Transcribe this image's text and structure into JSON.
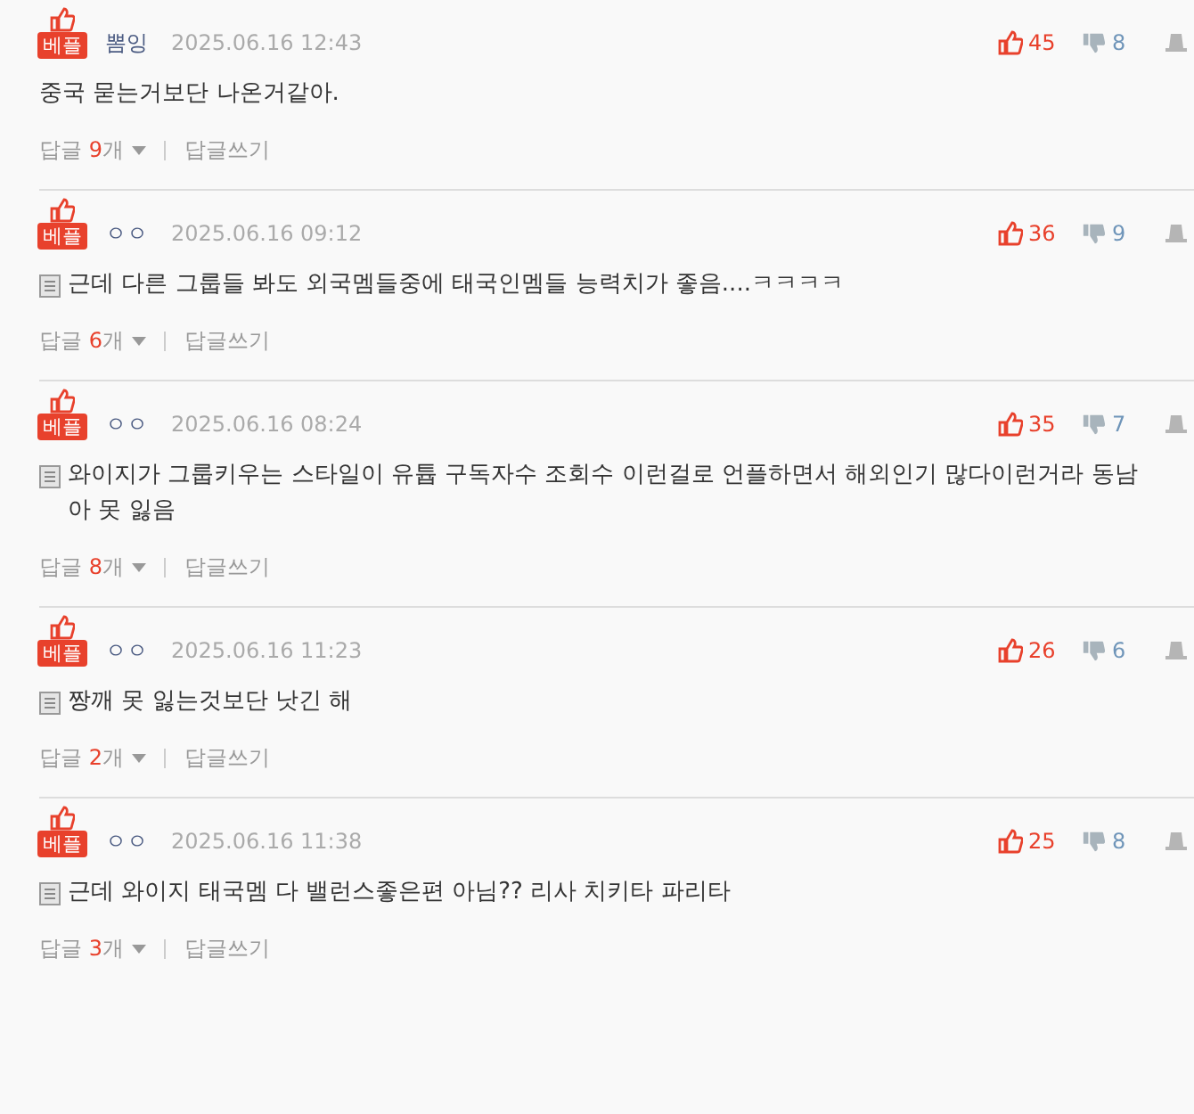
{
  "comments": [
    {
      "badge": "베플",
      "author": "뽐잉",
      "date": "2025.06.16 12:43",
      "up": "45",
      "down": "8",
      "memo_icon": false,
      "body": "중국 묻는거보단 나온거같아.",
      "reply_label": "답글",
      "reply_count": "9",
      "reply_unit": "개",
      "write_reply": "답글쓰기"
    },
    {
      "badge": "베플",
      "author": "ㅇㅇ",
      "date": "2025.06.16 09:12",
      "up": "36",
      "down": "9",
      "memo_icon": true,
      "body": "근데 다른 그룹들 봐도 외국멤들중에 태국인멤들 능력치가 좋음....ㅋㅋㅋㅋ",
      "reply_label": "답글",
      "reply_count": "6",
      "reply_unit": "개",
      "write_reply": "답글쓰기"
    },
    {
      "badge": "베플",
      "author": "ㅇㅇ",
      "date": "2025.06.16 08:24",
      "up": "35",
      "down": "7",
      "memo_icon": true,
      "body": "와이지가 그룹키우는 스타일이 유튭 구독자수 조회수 이런걸로 언플하면서 해외인기 많다이런거라 동남아 못 잃음",
      "reply_label": "답글",
      "reply_count": "8",
      "reply_unit": "개",
      "write_reply": "답글쓰기"
    },
    {
      "badge": "베플",
      "author": "ㅇㅇ",
      "date": "2025.06.16 11:23",
      "up": "26",
      "down": "6",
      "memo_icon": true,
      "body": "짱깨 못 잃는것보단 낫긴 해",
      "reply_label": "답글",
      "reply_count": "2",
      "reply_unit": "개",
      "write_reply": "답글쓰기"
    },
    {
      "badge": "베플",
      "author": "ㅇㅇ",
      "date": "2025.06.16 11:38",
      "up": "25",
      "down": "8",
      "memo_icon": true,
      "body": "근데 와이지 태국멤 다 밸런스좋은편 아님?? 리사 치키타 파리타",
      "reply_label": "답글",
      "reply_count": "3",
      "reply_unit": "개",
      "write_reply": "답글쓰기"
    }
  ]
}
